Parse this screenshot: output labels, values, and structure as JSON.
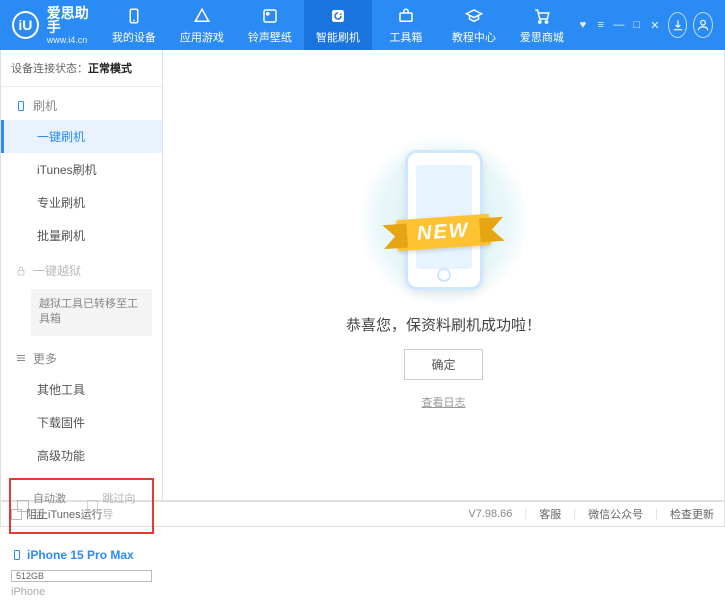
{
  "header": {
    "logo_letter": "iU",
    "title": "爱思助手",
    "url": "www.i4.cn",
    "nav": [
      {
        "label": "我的设备"
      },
      {
        "label": "应用游戏"
      },
      {
        "label": "铃声壁纸"
      },
      {
        "label": "智能刷机"
      },
      {
        "label": "工具箱"
      },
      {
        "label": "教程中心"
      },
      {
        "label": "爱思商城"
      }
    ]
  },
  "sidebar": {
    "status_label": "设备连接状态：",
    "status_value": "正常模式",
    "group_flash": "刷机",
    "items_flash": [
      "一键刷机",
      "iTunes刷机",
      "专业刷机",
      "批量刷机"
    ],
    "group_jailbreak": "一键越狱",
    "jailbreak_note": "越狱工具已转移至工具箱",
    "group_more": "更多",
    "items_more": [
      "其他工具",
      "下载固件",
      "高级功能"
    ],
    "cb_auto_activate": "自动激活",
    "cb_skip_guide": "跳过向导",
    "device_name": "iPhone 15 Pro Max",
    "device_storage": "512GB",
    "device_type": "iPhone"
  },
  "main": {
    "ribbon": "NEW",
    "success_text": "恭喜您，保资料刷机成功啦！",
    "ok_button": "确定",
    "log_link": "查看日志"
  },
  "footer": {
    "block_itunes": "阻止iTunes运行",
    "version": "V7.98.66",
    "links": [
      "客服",
      "微信公众号",
      "检查更新"
    ]
  }
}
